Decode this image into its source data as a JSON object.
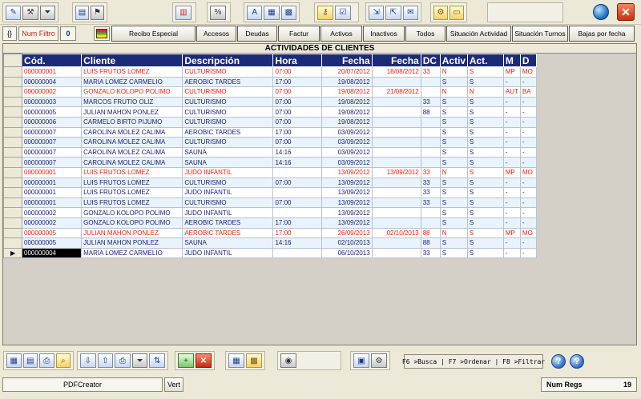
{
  "toolbar": {
    "icons": [
      "edit-icon",
      "tools-filter-icon",
      "filter-icon",
      "report-icon",
      "flag-icon",
      "chart-icon",
      "percent-icon",
      "text-icon",
      "grid-icon",
      "calendar-icon",
      "keys-icon",
      "checkbox-icon",
      "import-icon",
      "export-icon",
      "mail-icon",
      "tools-icon",
      "notes-icon",
      "globe-icon",
      "close-icon"
    ]
  },
  "filterbar": {
    "brace": "{}",
    "num_filtro_label": "Num Filtro",
    "num_filtro_value": "0",
    "buttons": [
      "Recibo Especial",
      "Accesos",
      "Deudas",
      "Factur",
      "Activos",
      "Inactivos",
      "Todos",
      "Situación Actividad",
      "Situación Turnos",
      "Bajas por fecha"
    ]
  },
  "grid": {
    "title": "ACTIVIDADES DE CLIENTES",
    "headers": [
      "Cód.",
      "Cliente",
      "Descripción",
      "Hora",
      "Fecha",
      "Fecha",
      "DC",
      "Activ",
      "Act.",
      "M",
      "D"
    ],
    "rows": [
      {
        "cod": "000000001",
        "cliente": "LUIS FRUTOS LOMEZ",
        "desc": "CULTURISMO",
        "hora": "07:00",
        "fecha1": "20/07/2012",
        "fecha2": "18/08/2012",
        "dc": "33",
        "activ": "N",
        "act": "S",
        "m": "MP",
        "d": "MO",
        "red": true
      },
      {
        "cod": "000000004",
        "cliente": "MARIA LOMEZ  CARMELIO",
        "desc": "AEROBIC TARDES",
        "hora": "17:00",
        "fecha1": "19/08/2012",
        "fecha2": "",
        "dc": "",
        "activ": "S",
        "act": "S",
        "m": "-",
        "d": "-",
        "red": false
      },
      {
        "cod": "000000002",
        "cliente": "GONZALO KOLOPO POLIMO",
        "desc": "CULTURISMO",
        "hora": "07:00",
        "fecha1": "19/08/2012",
        "fecha2": "21/08/2012",
        "dc": "",
        "activ": "N",
        "act": "N",
        "m": "AUT",
        "d": "BA",
        "red": true
      },
      {
        "cod": "000000003",
        "cliente": "MARCOS FRUTIO OLIZ",
        "desc": "CULTURISMO",
        "hora": "07:00",
        "fecha1": "19/08/2012",
        "fecha2": "",
        "dc": "33",
        "activ": "S",
        "act": "S",
        "m": "-",
        "d": "-",
        "red": false
      },
      {
        "cod": "000000005",
        "cliente": "JULIAN MAHON PONLEZ",
        "desc": "CULTURISMO",
        "hora": "07:00",
        "fecha1": "19/08/2012",
        "fecha2": "",
        "dc": "88",
        "activ": "S",
        "act": "S",
        "m": "-",
        "d": "-",
        "red": false
      },
      {
        "cod": "000000006",
        "cliente": "CARMELO BIRTO PIJUMO",
        "desc": "CULTURISMO",
        "hora": "07:00",
        "fecha1": "19/08/2012",
        "fecha2": "",
        "dc": "",
        "activ": "S",
        "act": "S",
        "m": "-",
        "d": "-",
        "red": false
      },
      {
        "cod": "000000007",
        "cliente": "CAROLINA MOLEZ CALIMA",
        "desc": "AEROBIC TARDES",
        "hora": "17:00",
        "fecha1": "03/09/2012",
        "fecha2": "",
        "dc": "",
        "activ": "S",
        "act": "S",
        "m": "-",
        "d": "-",
        "red": false
      },
      {
        "cod": "000000007",
        "cliente": "CAROLINA MOLEZ CALIMA",
        "desc": "CULTURISMO",
        "hora": "07:00",
        "fecha1": "03/09/2012",
        "fecha2": "",
        "dc": "",
        "activ": "S",
        "act": "S",
        "m": "-",
        "d": "-",
        "red": false
      },
      {
        "cod": "000000007",
        "cliente": "CAROLINA MOLEZ CALIMA",
        "desc": "SAUNA",
        "hora": "14:16",
        "fecha1": "03/09/2012",
        "fecha2": "",
        "dc": "",
        "activ": "S",
        "act": "S",
        "m": "-",
        "d": "-",
        "red": false
      },
      {
        "cod": "000000007",
        "cliente": "CAROLINA MOLEZ CALIMA",
        "desc": "SAUNA",
        "hora": "14:16",
        "fecha1": "03/09/2012",
        "fecha2": "",
        "dc": "",
        "activ": "S",
        "act": "S",
        "m": "-",
        "d": "-",
        "red": false
      },
      {
        "cod": "000000001",
        "cliente": "LUIS FRUTOS LOMEZ",
        "desc": "JUDO INFANTIL",
        "hora": "",
        "fecha1": "13/09/2012",
        "fecha2": "13/09/2012",
        "dc": "33",
        "activ": "N",
        "act": "S",
        "m": "MP",
        "d": "MO",
        "red": true
      },
      {
        "cod": "000000001",
        "cliente": "LUIS FRUTOS LOMEZ",
        "desc": "CULTURISMO",
        "hora": "07:00",
        "fecha1": "13/09/2012",
        "fecha2": "",
        "dc": "33",
        "activ": "S",
        "act": "S",
        "m": "-",
        "d": "-",
        "red": false
      },
      {
        "cod": "000000001",
        "cliente": "LUIS FRUTOS LOMEZ",
        "desc": "JUDO INFANTIL",
        "hora": "",
        "fecha1": "13/09/2012",
        "fecha2": "",
        "dc": "33",
        "activ": "S",
        "act": "S",
        "m": "-",
        "d": "-",
        "red": false
      },
      {
        "cod": "000000001",
        "cliente": "LUIS FRUTOS LOMEZ",
        "desc": "CULTURISMO",
        "hora": "07:00",
        "fecha1": "13/09/2012",
        "fecha2": "",
        "dc": "33",
        "activ": "S",
        "act": "S",
        "m": "-",
        "d": "-",
        "red": false
      },
      {
        "cod": "000000002",
        "cliente": "GONZALO KOLOPO POLIMO",
        "desc": "JUDO INFANTIL",
        "hora": "",
        "fecha1": "13/09/2012",
        "fecha2": "",
        "dc": "",
        "activ": "S",
        "act": "S",
        "m": "-",
        "d": "-",
        "red": false
      },
      {
        "cod": "000000002",
        "cliente": "GONZALO KOLOPO POLIMO",
        "desc": "AEROBIC TARDES",
        "hora": "17:00",
        "fecha1": "13/09/2012",
        "fecha2": "",
        "dc": "",
        "activ": "S",
        "act": "S",
        "m": "-",
        "d": "-",
        "red": false
      },
      {
        "cod": "000000005",
        "cliente": "JULIAN MAHON PONLEZ",
        "desc": "AEROBIC TARDES",
        "hora": "17:00",
        "fecha1": "26/09/2013",
        "fecha2": "02/10/2013",
        "dc": "88",
        "activ": "N",
        "act": "S",
        "m": "MP",
        "d": "MO",
        "red": true
      },
      {
        "cod": "000000005",
        "cliente": "JULIAN MAHON PONLEZ",
        "desc": "SAUNA",
        "hora": "14:16",
        "fecha1": "02/10/2013",
        "fecha2": "",
        "dc": "88",
        "activ": "S",
        "act": "S",
        "m": "-",
        "d": "-",
        "red": false
      },
      {
        "cod": "000000004",
        "cliente": "MARIA LOMEZ  CARMELIO",
        "desc": "JUDO INFANTIL",
        "hora": "",
        "fecha1": "06/10/2013",
        "fecha2": "",
        "dc": "33",
        "activ": "S",
        "act": "S",
        "m": "-",
        "d": "-",
        "red": false
      }
    ],
    "selected_index": 18,
    "row_pointer": "▶"
  },
  "bottombar": {
    "hint": "F6 >Busca | F7 >Ordenar | F8 >Filtrar",
    "icons": [
      "add-row-icon",
      "edit-row-icon",
      "print-icon",
      "search-icon",
      "import-icon",
      "export-icon",
      "report-print-icon",
      "filter-icon",
      "sort-az-icon",
      "new-doc-icon",
      "delete-icon",
      "calculator-icon",
      "calendar-icon",
      "camera-icon",
      "image-icon",
      "settings-icon",
      "help-icon",
      "help-doc-icon"
    ]
  },
  "statusbar": {
    "pdf_label": "PDFCreator",
    "vert_label": "Vert",
    "num_regs_label": "Num Regs",
    "num_regs_value": "19"
  }
}
